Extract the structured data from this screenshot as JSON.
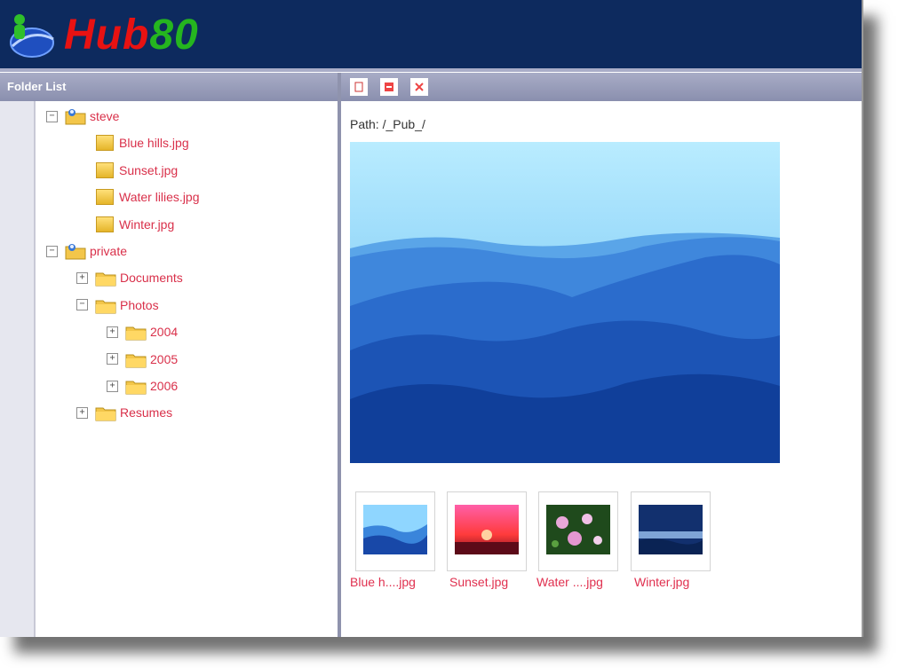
{
  "app": {
    "logo_part1": "Hub",
    "logo_part2": "80"
  },
  "colors": {
    "header_bg": "#0d2a5e",
    "link": "#d9304a",
    "logo_red": "#e81212",
    "logo_green": "#25b51f"
  },
  "left_panel": {
    "title": "Folder List",
    "tree": [
      {
        "label": "steve",
        "level": 0,
        "type": "user-folder",
        "toggle": "−"
      },
      {
        "label": "Blue hills.jpg",
        "level": 1,
        "type": "file"
      },
      {
        "label": "Sunset.jpg",
        "level": 1,
        "type": "file"
      },
      {
        "label": "Water lilies.jpg",
        "level": 1,
        "type": "file"
      },
      {
        "label": "Winter.jpg",
        "level": 1,
        "type": "file"
      },
      {
        "label": "private",
        "level": 0,
        "type": "user-folder",
        "toggle": "−"
      },
      {
        "label": "Documents",
        "level": 1,
        "type": "folder",
        "toggle": "+"
      },
      {
        "label": "Photos",
        "level": 1,
        "type": "folder",
        "toggle": "−"
      },
      {
        "label": "2004",
        "level": 2,
        "type": "folder",
        "toggle": "+"
      },
      {
        "label": "2005",
        "level": 2,
        "type": "folder",
        "toggle": "+"
      },
      {
        "label": "2006",
        "level": 2,
        "type": "folder",
        "toggle": "+"
      },
      {
        "label": "Resumes",
        "level": 1,
        "type": "folder",
        "toggle": "+"
      }
    ]
  },
  "right_panel": {
    "path_label": "Path: /_Pub_/",
    "toolbar": [
      {
        "icon": "page-icon"
      },
      {
        "icon": "minus-icon"
      },
      {
        "icon": "close-icon"
      }
    ],
    "thumbnails": [
      {
        "label": "Blue h....jpg",
        "image": "blue-hills"
      },
      {
        "label": "Sunset.jpg",
        "image": "sunset"
      },
      {
        "label": "Water ....jpg",
        "image": "water-lilies"
      },
      {
        "label": "Winter.jpg",
        "image": "winter"
      }
    ]
  }
}
